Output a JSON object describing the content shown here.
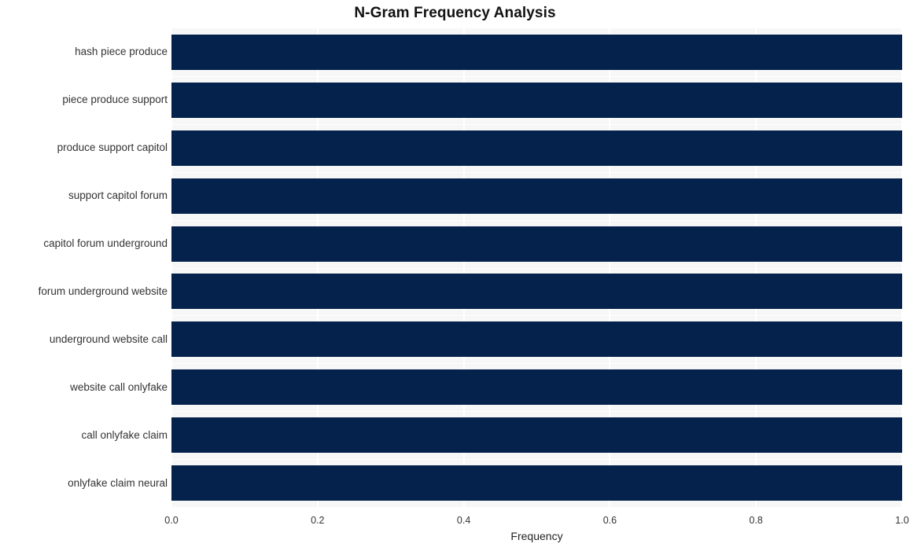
{
  "chart_data": {
    "type": "bar",
    "orientation": "horizontal",
    "title": "N-Gram Frequency Analysis",
    "xlabel": "Frequency",
    "ylabel": "",
    "xlim": [
      0.0,
      1.0
    ],
    "xticks": [
      "0.0",
      "0.2",
      "0.4",
      "0.6",
      "0.8",
      "1.0"
    ],
    "xtick_values": [
      0.0,
      0.2,
      0.4,
      0.6,
      0.8,
      1.0
    ],
    "grid": true,
    "legend": "none",
    "bar_color": "#04224c",
    "plot_background": "#f7f7f7",
    "figure_background": "#ffffff",
    "categories": [
      "hash piece produce",
      "piece produce support",
      "produce support capitol",
      "support capitol forum",
      "capitol forum underground",
      "forum underground website",
      "underground website call",
      "website call onlyfake",
      "call onlyfake claim",
      "onlyfake claim neural"
    ],
    "values": [
      1.0,
      1.0,
      1.0,
      1.0,
      1.0,
      1.0,
      1.0,
      1.0,
      1.0,
      1.0
    ]
  }
}
